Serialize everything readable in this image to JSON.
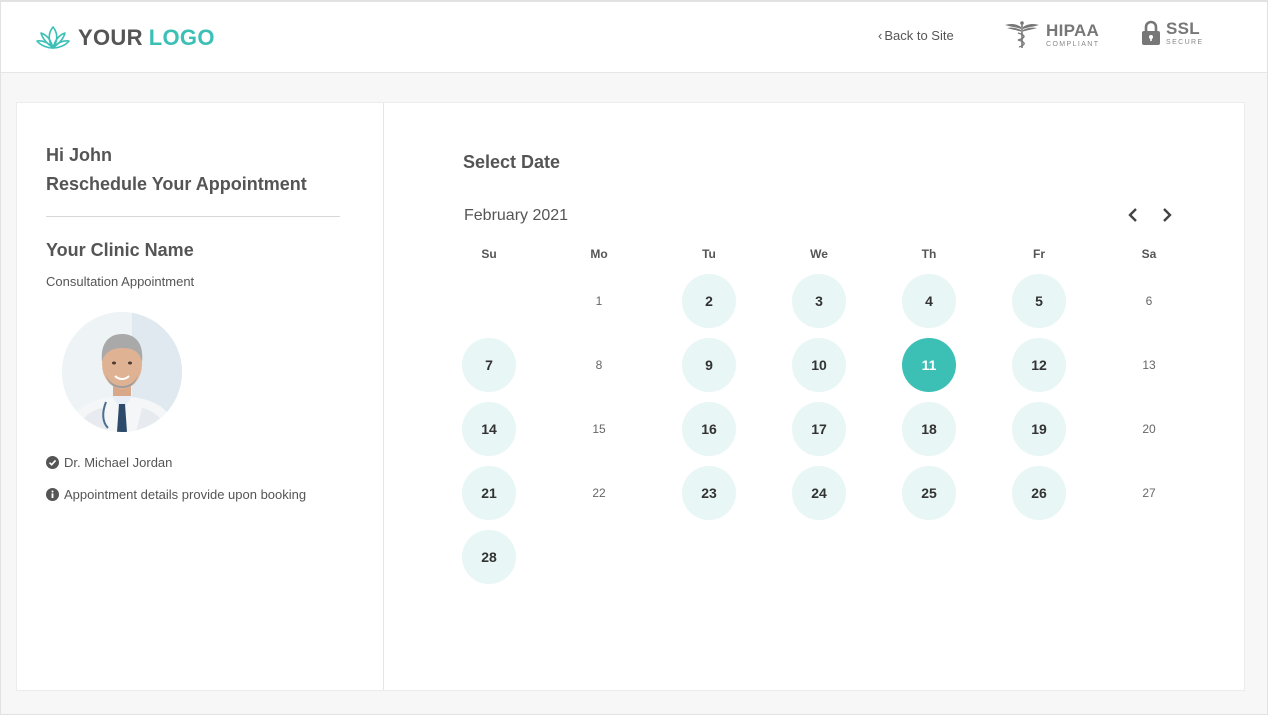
{
  "header": {
    "logo_word1": "YOUR",
    "logo_word2": "LOGO",
    "back_label": "Back to Site",
    "hipaa_title": "HIPAA",
    "hipaa_sub": "COMPLIANT",
    "ssl_title": "SSL",
    "ssl_sub": "SECURE"
  },
  "sidebar": {
    "greeting": "Hi John",
    "heading": "Reschedule Your Appointment",
    "clinic_name": "Your Clinic Name",
    "appointment_type": "Consultation Appointment",
    "doctor": "Dr. Michael Jordan",
    "details_note": "Appointment details provide upon booking"
  },
  "calendar": {
    "title": "Select Date",
    "month_label": "February 2021",
    "weekdays": [
      "Su",
      "Mo",
      "Tu",
      "We",
      "Th",
      "Fr",
      "Sa"
    ],
    "first_weekday_index": 1,
    "days_in_month": 28,
    "available_days": [
      2,
      3,
      4,
      5,
      7,
      9,
      10,
      11,
      12,
      14,
      16,
      17,
      18,
      19,
      21,
      23,
      24,
      25,
      26,
      28
    ],
    "selected_day": 11
  },
  "colors": {
    "accent": "#3cc0b6",
    "available_bg": "#e8f6f5"
  }
}
